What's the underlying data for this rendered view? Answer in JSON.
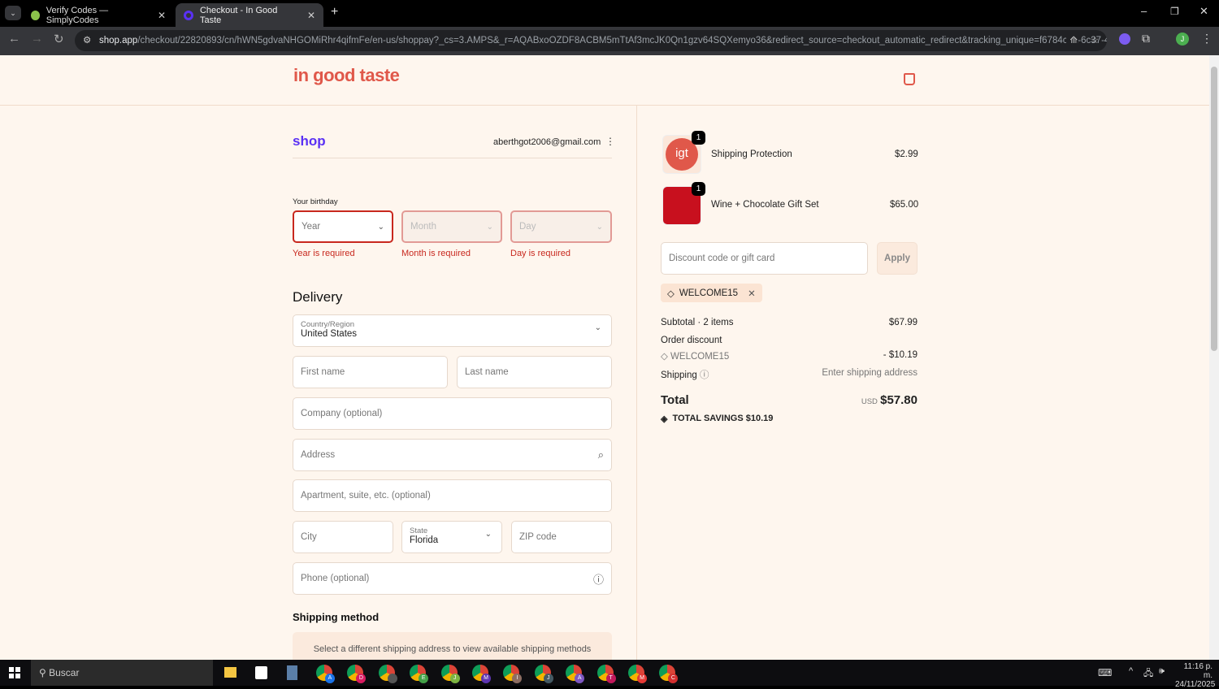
{
  "browser": {
    "tabs": [
      {
        "title": "Verify Codes — SimplyCodes"
      },
      {
        "title": "Checkout - In Good Taste"
      }
    ],
    "url_host": "shop.app",
    "url_path": "/checkout/22820893/cn/hWN5gdvaNHGOMiRhr4qifmFe/en-us/shoppay?_cs=3.AMPS&_r=AQABxoOZDF8ACBM5mTtAf3mcJK0Qn1gzv64SQXemyo36&redirect_source=checkout_automatic_redirect&tracking_unique=f6784c8a-6c37-4a...",
    "profile": "J"
  },
  "store": {
    "logo": "in good taste"
  },
  "shop": {
    "logo": "shop",
    "email": "aberthgot2006@gmail.com"
  },
  "birthday": {
    "label": "Your birthday",
    "year": "Year",
    "month": "Month",
    "day": "Day",
    "year_err": "Year is required",
    "month_err": "Month is required",
    "day_err": "Day is required"
  },
  "delivery": {
    "heading": "Delivery",
    "country_label": "Country/Region",
    "country": "United States",
    "first": "First name",
    "last": "Last name",
    "company": "Company (optional)",
    "address": "Address",
    "apt": "Apartment, suite, etc. (optional)",
    "city": "City",
    "state_label": "State",
    "state": "Florida",
    "zip": "ZIP code",
    "phone": "Phone (optional)"
  },
  "shipping_method": {
    "heading": "Shipping method",
    "notice": "Select a different shipping address to view available shipping methods"
  },
  "cart": {
    "items": [
      {
        "name": "Shipping Protection",
        "price": "$2.99",
        "qty": "1"
      },
      {
        "name": "Wine + Chocolate Gift Set",
        "price": "$65.00",
        "qty": "1"
      }
    ],
    "discount_placeholder": "Discount code or gift card",
    "apply": "Apply",
    "code": "WELCOME15",
    "subtotal_label": "Subtotal · 2 items",
    "subtotal": "$67.99",
    "order_discount": "Order discount",
    "discount_amount": "- $10.19",
    "shipping_label": "Shipping",
    "shipping_value": "Enter shipping address",
    "total_label": "Total",
    "currency": "USD",
    "total": "$57.80",
    "savings": "TOTAL SAVINGS  $10.19"
  },
  "taskbar": {
    "search": "Buscar",
    "time": "11:16 p. m.",
    "date": "24/11/2025",
    "chrome_profiles": [
      "A",
      "D",
      "",
      "E",
      "J",
      "M",
      "I",
      "J",
      "A",
      "T",
      "M",
      "C"
    ]
  },
  "colors": {
    "accent": "#5a31f4",
    "brand": "#e0584a",
    "error": "#c8281e"
  }
}
